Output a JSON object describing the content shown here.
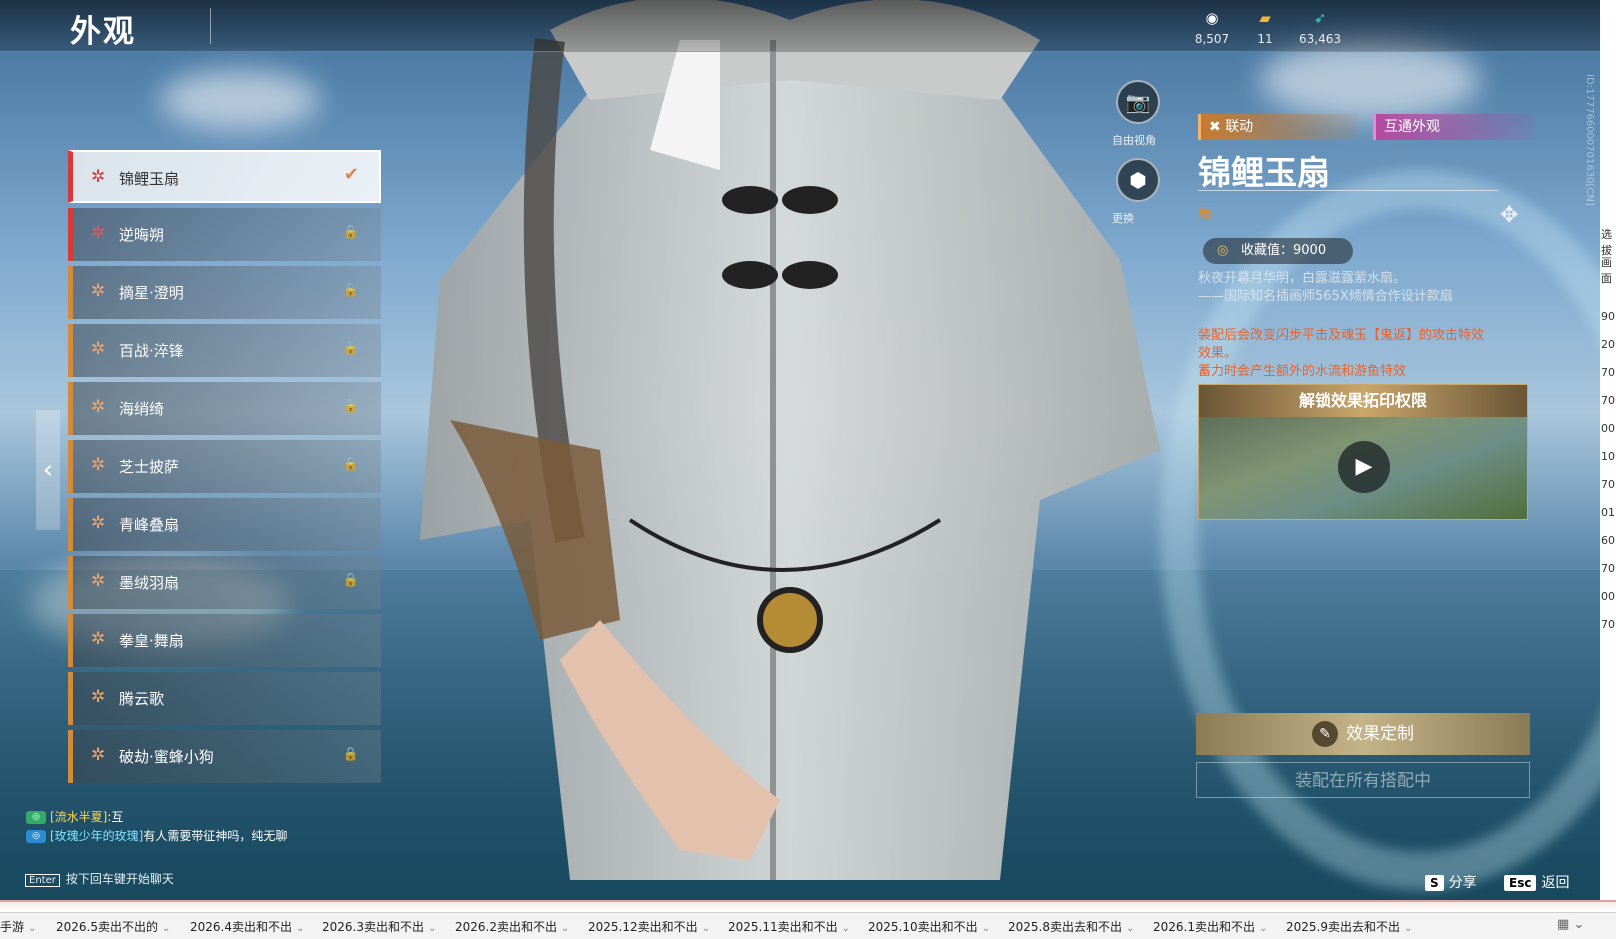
{
  "header": {
    "title": "外观",
    "currencies": [
      {
        "icon": "jade-icon",
        "value": "8,507"
      },
      {
        "icon": "ticket-icon",
        "value": "11"
      },
      {
        "icon": "feather-icon",
        "value": "63,463"
      }
    ]
  },
  "items": [
    {
      "label": "锦鲤玉扇",
      "rarity": "red",
      "state": "selected"
    },
    {
      "label": "逆晦朔",
      "rarity": "red",
      "state": "locked"
    },
    {
      "label": "摘星·澄明",
      "rarity": "orange",
      "state": "locked"
    },
    {
      "label": "百战·淬锋",
      "rarity": "orange",
      "state": "locked"
    },
    {
      "label": "海绡绮",
      "rarity": "orange",
      "state": "locked"
    },
    {
      "label": "芝士披萨",
      "rarity": "orange",
      "state": "locked"
    },
    {
      "label": "青峰叠扇",
      "rarity": "orange",
      "state": "owned"
    },
    {
      "label": "墨绒羽扇",
      "rarity": "orange",
      "state": "locked"
    },
    {
      "label": "拳皇·舞扇",
      "rarity": "orange",
      "state": "owned"
    },
    {
      "label": "腾云歌",
      "rarity": "orange",
      "state": "owned"
    },
    {
      "label": "破劫·蜜蜂小狗",
      "rarity": "orange",
      "state": "locked"
    }
  ],
  "chat": {
    "line1_name": "[流水半夏]",
    "line1_text": ":互",
    "line2_name": "[玫瑰少年的玫瑰]",
    "line2_text": "有人需要带征神吗，纯无聊",
    "enter_key": "Enter",
    "hint": "按下回车键开始聊天"
  },
  "side_buttons": {
    "camera_label": "自由视角",
    "swap_label": "更换"
  },
  "detail": {
    "tag_linkage": "联动",
    "tag_shared": "互通外观",
    "title": "锦鲤玉扇",
    "type": "扇",
    "collection": "收藏值：9000",
    "desc_grey_1": "秋夜开幕月华明，白露滋露萦水扇。",
    "desc_grey_2": "——国际知名插画师565X倾情合作设计款扇",
    "desc_orange_1": "装配后会改变闪步平击及魂玉【鬼返】的攻击特效",
    "desc_orange_2": "效果。",
    "desc_orange_3": "蓄力时会产生额外的水流和游鱼特效",
    "unlock_title": "解锁效果拓印权限",
    "effect_button": "效果定制",
    "equip_all": "装配在所有搭配中",
    "vertical_id": "ID:177766000701630[CN]"
  },
  "hotkeys": {
    "share_key": "S",
    "share_label": "分享",
    "back_key": "Esc",
    "back_label": "返回"
  },
  "sheet_tabs": [
    "手游",
    "2026.5卖出不出的",
    "2026.4卖出和不出",
    "2026.3卖出和不出",
    "2026.2卖出和不出",
    "2025.12卖出和不出",
    "2025.11卖出和不出",
    "2025.10卖出和不出",
    "2025.8卖出去和不出",
    "2026.1卖出和不出",
    "2025.9卖出去和不出"
  ],
  "edge_cells": [
    "选拔",
    "画面",
    "",
    "90",
    "20",
    "70",
    "70",
    "00",
    "10",
    "70",
    "01",
    "60",
    "70",
    "00",
    "70"
  ],
  "colors": {
    "accent_orange": "#d38a3c",
    "accent_red": "#d43a3a",
    "desc_orange": "#e8622e",
    "gold": "#c9a66b"
  }
}
